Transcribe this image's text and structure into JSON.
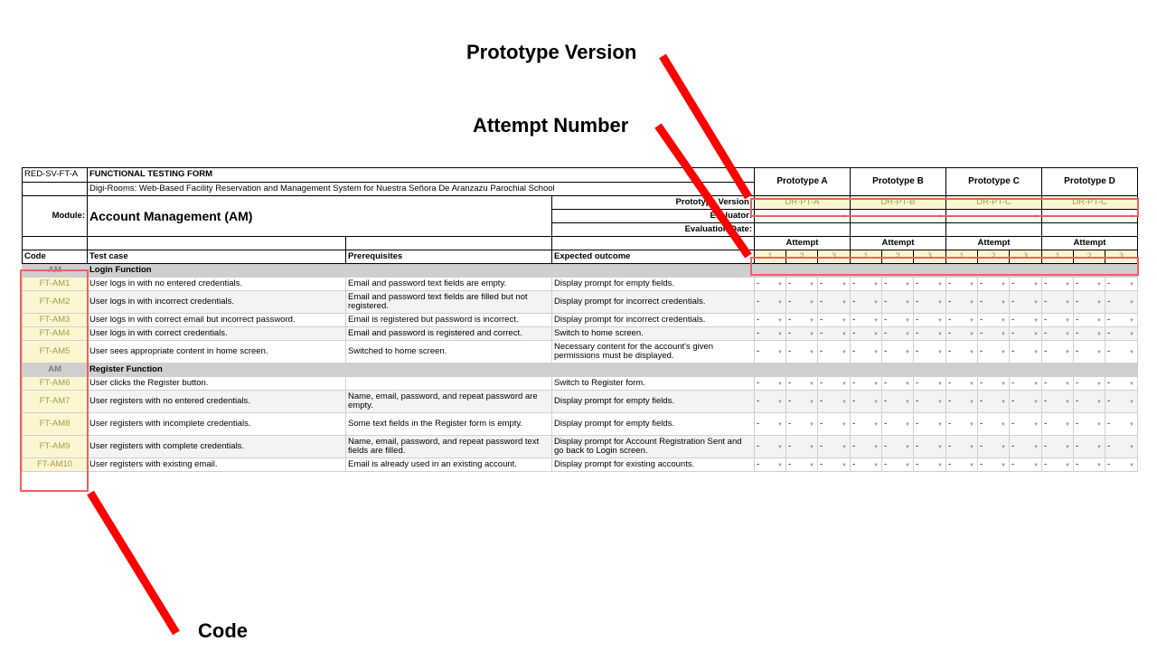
{
  "callouts": {
    "prototype_version": "Prototype Version",
    "attempt_number": "Attempt Number",
    "code": "Code"
  },
  "form": {
    "form_id": "RED-SV-FT-A",
    "form_title": "FUNCTIONAL TESTING FORM",
    "project": "Digi-Rooms: Web-Based Facility Reservation and Management System for Nuestra Señora De Aranzazu Parochial School",
    "module_label": "Module:",
    "module_value": "Account Management (AM)",
    "prototype_version_label": "Prototype Version:",
    "evaluator_label": "Evaluator:",
    "evaluation_date_label": "Evaluation Date:"
  },
  "prototypes": [
    {
      "name": "Prototype A",
      "version": "DR-PT-A",
      "evaluator": "-"
    },
    {
      "name": "Prototype B",
      "version": "DR-PT-B",
      "evaluator": ""
    },
    {
      "name": "Prototype C",
      "version": "DR-PT-C",
      "evaluator": ""
    },
    {
      "name": "Prototype D",
      "version": "DR-PT-C",
      "evaluator": ""
    }
  ],
  "attempt_label": "Attempt",
  "attempt_numbers": [
    "1",
    "2",
    "3"
  ],
  "columns": {
    "code": "Code",
    "test_case": "Test case",
    "prerequisites": "Prerequisites",
    "expected": "Expected outcome"
  },
  "dropdown_value": "-",
  "sections": [
    {
      "code": "AM",
      "title": "Login Function",
      "rows": [
        {
          "code": "FT-AM1",
          "test": "User logs in with no entered credentials.",
          "prereq": "Email and password text fields are empty.",
          "expected": "Display prompt for empty fields."
        },
        {
          "code": "FT-AM2",
          "test": "User logs in with incorrect credentials.",
          "prereq": "Email and password text fields are filled but not registered.",
          "expected": "Display prompt for incorrect credentials."
        },
        {
          "code": "FT-AM3",
          "test": "User logs in with correct email but incorrect password.",
          "prereq": "Email is registered but password is incorrect.",
          "expected": "Display prompt for incorrect credentials."
        },
        {
          "code": "FT-AM4",
          "test": "User logs in with correct credentials.",
          "prereq": "Email and password is registered and correct.",
          "expected": "Switch to home screen."
        },
        {
          "code": "FT-AM5",
          "test": "User sees appropriate content in home screen.",
          "prereq": "Switched to home screen.",
          "expected": "Necessary content for the account's given permissions must be displayed."
        }
      ]
    },
    {
      "code": "AM",
      "title": "Register Function",
      "rows": [
        {
          "code": "FT-AM6",
          "test": "User clicks the Register button.",
          "prereq": "",
          "expected": "Switch to Register form."
        },
        {
          "code": "FT-AM7",
          "test": "User registers with no entered credentials.",
          "prereq": "Name, email, password, and repeat password are empty.",
          "expected": "Display prompt for empty fields."
        },
        {
          "code": "FT-AM8",
          "test": "User registers with incomplete credentials.",
          "prereq": "Some text fields in the Register form is empty.",
          "expected": "Display prompt for empty fields."
        },
        {
          "code": "FT-AM9",
          "test": "User registers with complete credentials.",
          "prereq": "Name, email, password, and repeat password text fields are filled.",
          "expected": "Display prompt for Account Registration Sent and go back to Login screen."
        },
        {
          "code": "FT-AM10",
          "test": "User registers with existing email.",
          "prereq": "Email is already used in an existing account.",
          "expected": "Display prompt for existing accounts."
        }
      ]
    }
  ],
  "colors": {
    "callout_red": "#ff0000",
    "highlight_yellow": "#fbf6cf",
    "code_text": "#a59a4e",
    "section_grey": "#cfcfcf",
    "box_red": "#f06060"
  }
}
